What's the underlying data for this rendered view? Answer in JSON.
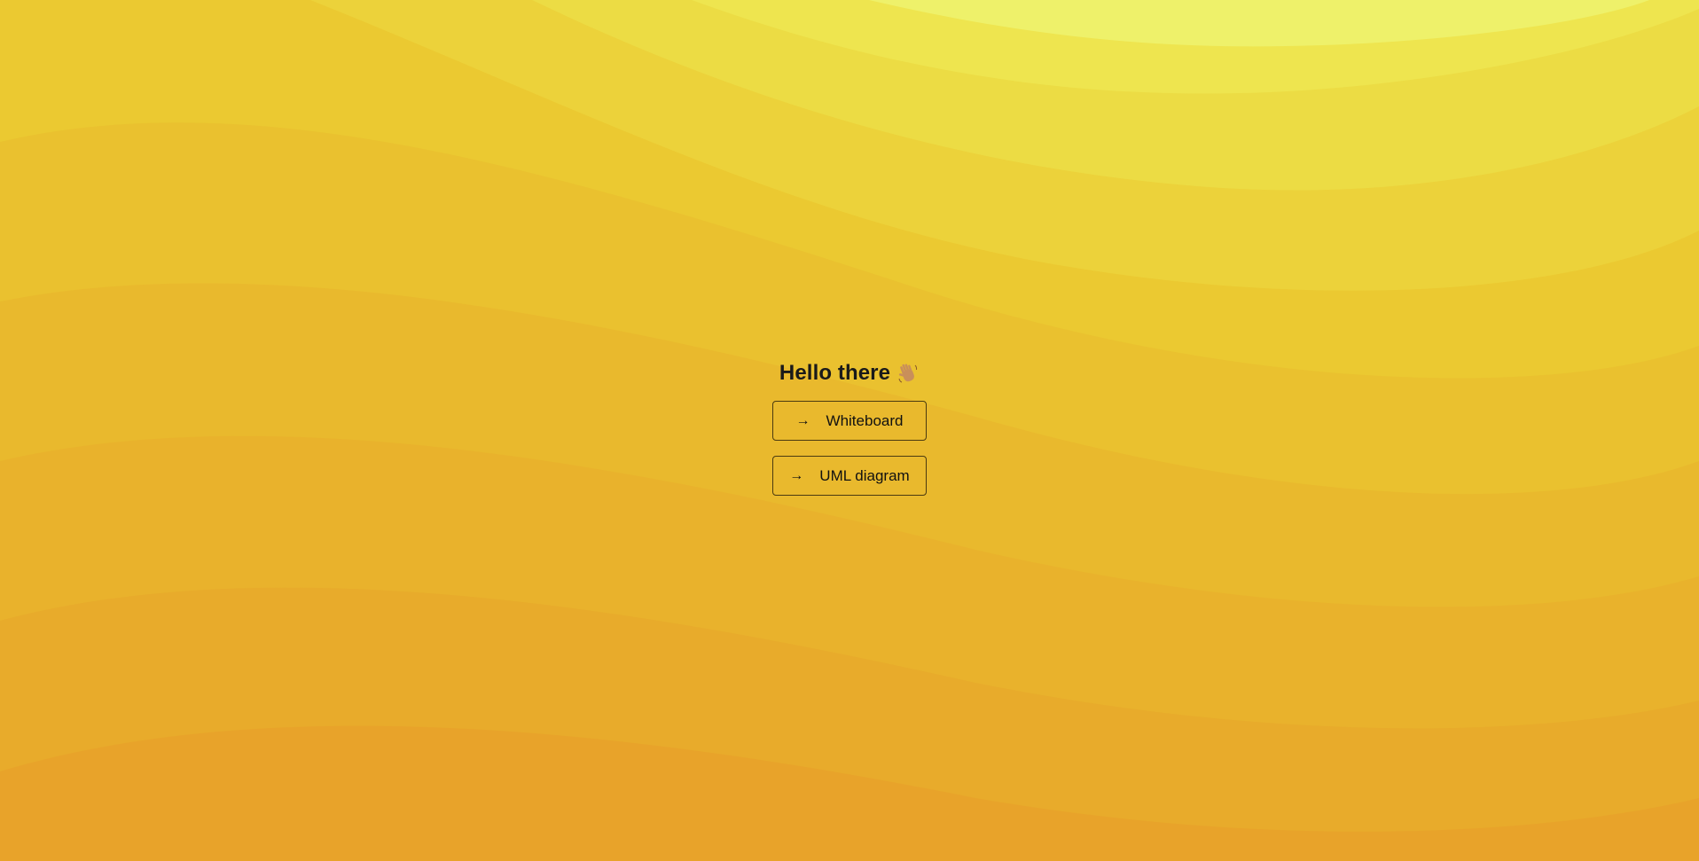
{
  "greeting": {
    "title": "Hello there",
    "emoji_icon": "waving-hand-icon"
  },
  "actions": [
    {
      "label": "Whiteboard",
      "icon": "arrow-right-icon"
    },
    {
      "label": "UML diagram",
      "icon": "arrow-right-icon"
    }
  ],
  "colors": {
    "background_top": "#eef56a",
    "background_bottom": "#e8a42a",
    "button_border": "#4a3a10",
    "text": "#111111"
  }
}
